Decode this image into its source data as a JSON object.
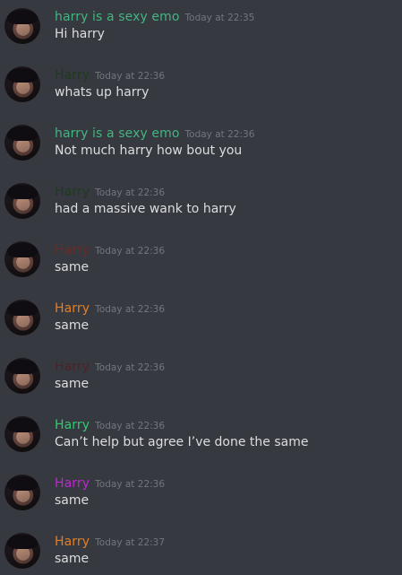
{
  "messages": [
    {
      "author": "harry is a sexy emo",
      "author_color": "#43b581",
      "timestamp": "Today at 22:35",
      "text": "Hi harry"
    },
    {
      "author": "Harry",
      "author_color": "#1f3a1d",
      "timestamp": "Today at 22:36",
      "text": "whats up harry"
    },
    {
      "author": "harry is a sexy emo",
      "author_color": "#43b581",
      "timestamp": "Today at 22:36",
      "text": "Not much harry how bout you"
    },
    {
      "author": "Harry",
      "author_color": "#1f3a1d",
      "timestamp": "Today at 22:36",
      "text": "had a massive wank to harry"
    },
    {
      "author": "Harry",
      "author_color": "#6d2a26",
      "timestamp": "Today at 22:36",
      "text": "same"
    },
    {
      "author": "Harry",
      "author_color": "#e67e22",
      "timestamp": "Today at 22:36",
      "text": "same"
    },
    {
      "author": "Harry",
      "author_color": "#4d2326",
      "timestamp": "Today at 22:36",
      "text": "same"
    },
    {
      "author": "Harry",
      "author_color": "#2ecc71",
      "timestamp": "Today at 22:36",
      "text": "Can’t help but agree I’ve done the same"
    },
    {
      "author": "Harry",
      "author_color": "#c026d3",
      "timestamp": "Today at 22:36",
      "text": "same"
    },
    {
      "author": "Harry",
      "author_color": "#e67e22",
      "timestamp": "Today at 22:37",
      "text": "same"
    }
  ]
}
